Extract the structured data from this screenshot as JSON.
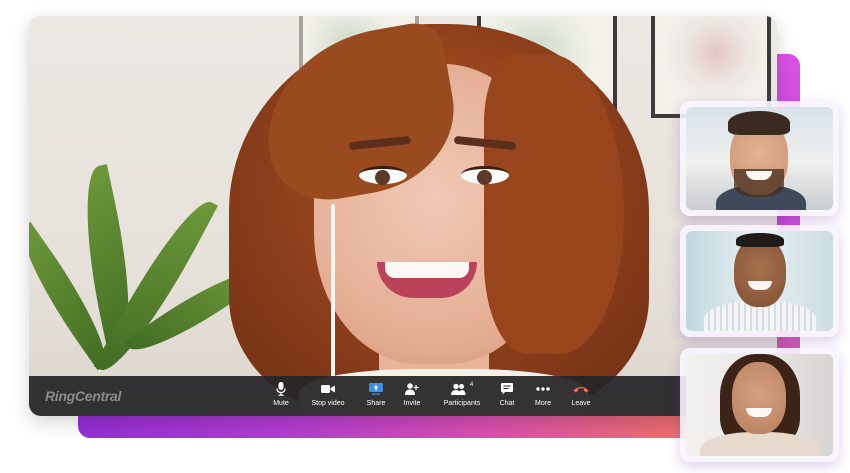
{
  "brand": {
    "name": "RingCentral"
  },
  "toolbar": {
    "buttons": [
      {
        "id": "mute",
        "label": "Mute",
        "icon": "microphone-icon"
      },
      {
        "id": "stop_video",
        "label": "Stop video",
        "icon": "video-camera-icon"
      },
      {
        "id": "share",
        "label": "Share",
        "icon": "share-screen-icon"
      },
      {
        "id": "invite",
        "label": "Invite",
        "icon": "add-person-icon"
      },
      {
        "id": "participants",
        "label": "Participants",
        "icon": "participants-icon",
        "count": "4"
      },
      {
        "id": "chat",
        "label": "Chat",
        "icon": "chat-bubble-icon"
      },
      {
        "id": "more",
        "label": "More",
        "icon": "more-dots-icon"
      },
      {
        "id": "leave",
        "label": "Leave",
        "icon": "phone-hangup-icon"
      }
    ]
  },
  "participants_thumbnails": [
    {
      "id": "participant-1"
    },
    {
      "id": "participant-2"
    },
    {
      "id": "participant-3"
    }
  ],
  "colors": {
    "toolbar_bg": "#262628",
    "share_accent": "#3b8fe8",
    "leave_accent": "#ff6b4a",
    "gradient_start": "#8a2ad6",
    "gradient_end": "#f2874e"
  }
}
